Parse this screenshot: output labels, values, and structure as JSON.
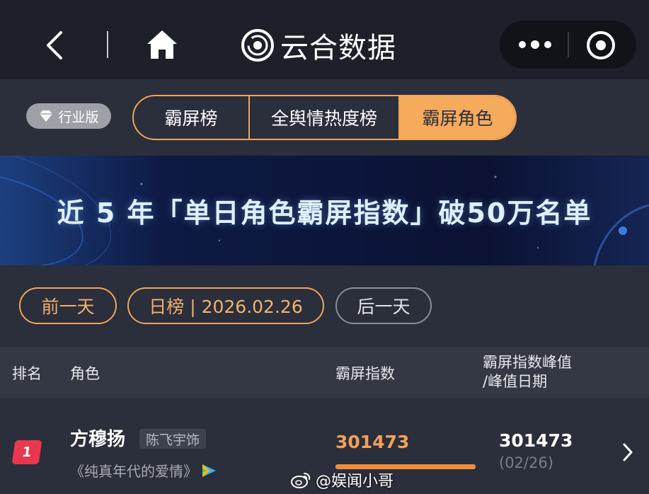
{
  "navbar": {
    "brand_name": "云合数据",
    "icons": [
      "back-icon",
      "home-icon",
      "brand-logo-icon",
      "more-icon",
      "close-circle-icon"
    ]
  },
  "tabrow": {
    "edition_label": "行业版",
    "tabs": [
      {
        "label": "霸屏榜",
        "active": false
      },
      {
        "label": "全舆情热度榜",
        "active": false
      },
      {
        "label": "霸屏角色",
        "active": true
      }
    ]
  },
  "banner": {
    "title": "近 5 年「单日角色霸屏指数」破50万名单"
  },
  "date_nav": {
    "prev_label": "前一天",
    "current_label": "日榜 | 2026.02.26",
    "next_label": "后一天"
  },
  "table": {
    "headers": {
      "rank": "排名",
      "role": "角色",
      "index": "霸屏指数",
      "peak_line1": "霸屏指数峰值",
      "peak_line2": "/峰值日期"
    },
    "rows": [
      {
        "rank": "1",
        "role_name": "方穆扬",
        "actor": "陈飞宇饰",
        "drama": "《纯真年代的爱情》",
        "score": "301473",
        "score_bar_fraction": 1.0,
        "peak_value": "301473",
        "peak_date": "(02/26)"
      }
    ]
  },
  "watermark": {
    "text": "@娱闻小哥"
  },
  "colors": {
    "accent_orange": "#f5aa5c",
    "rank_red": "#e8384f",
    "background": "#2b2e3b",
    "navbar": "#1e2029"
  }
}
